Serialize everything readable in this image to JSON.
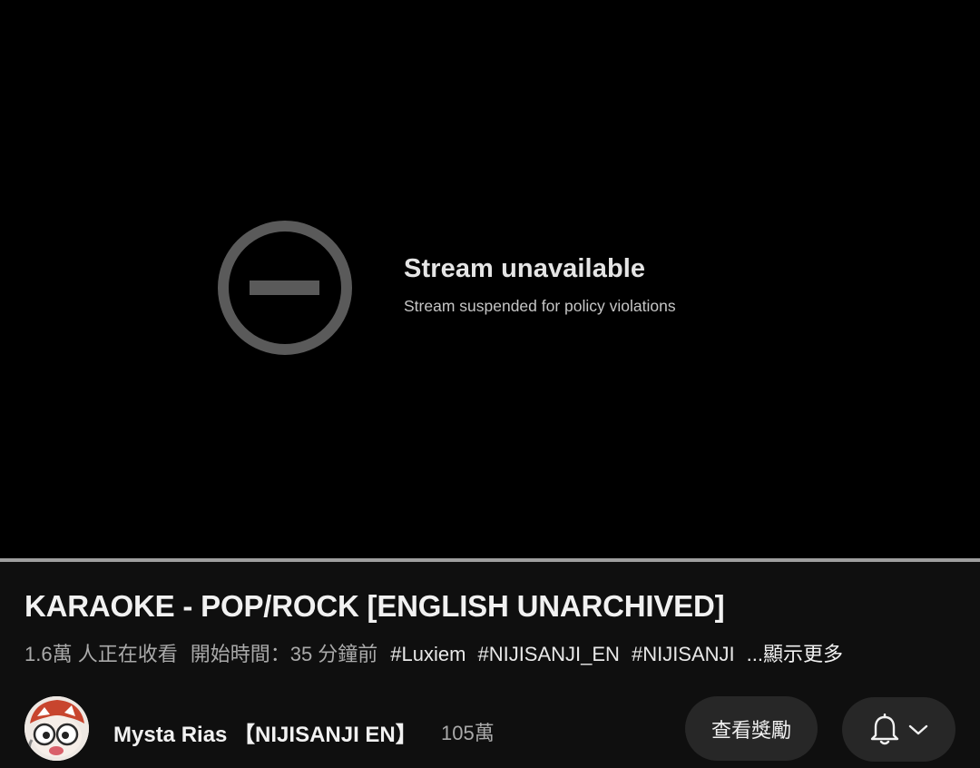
{
  "player": {
    "status_title": "Stream unavailable",
    "status_message": "Stream suspended for policy violations",
    "status_icon": "unavailable-icon"
  },
  "video": {
    "title": "KARAOKE - POP/ROCK [ENGLISH UNARCHIVED]",
    "viewers": "1.6萬 人正在收看",
    "started": "開始時間：35 分鐘前",
    "tags": [
      "#Luxiem",
      "#NIJISANJI_EN",
      "#NIJISANJI"
    ],
    "show_more": "...顯示更多"
  },
  "channel": {
    "name": "Mysta Rias 【NIJISANJI EN】",
    "subscribers": "105萬",
    "rewards_label": "查看獎勵",
    "notify_icon": "bell-icon",
    "dropdown_icon": "chevron-down-icon"
  },
  "colors": {
    "background": "#0f0f0f",
    "player_background": "#000000",
    "button_background": "#272727",
    "secondary_text": "#aaaaaa"
  }
}
